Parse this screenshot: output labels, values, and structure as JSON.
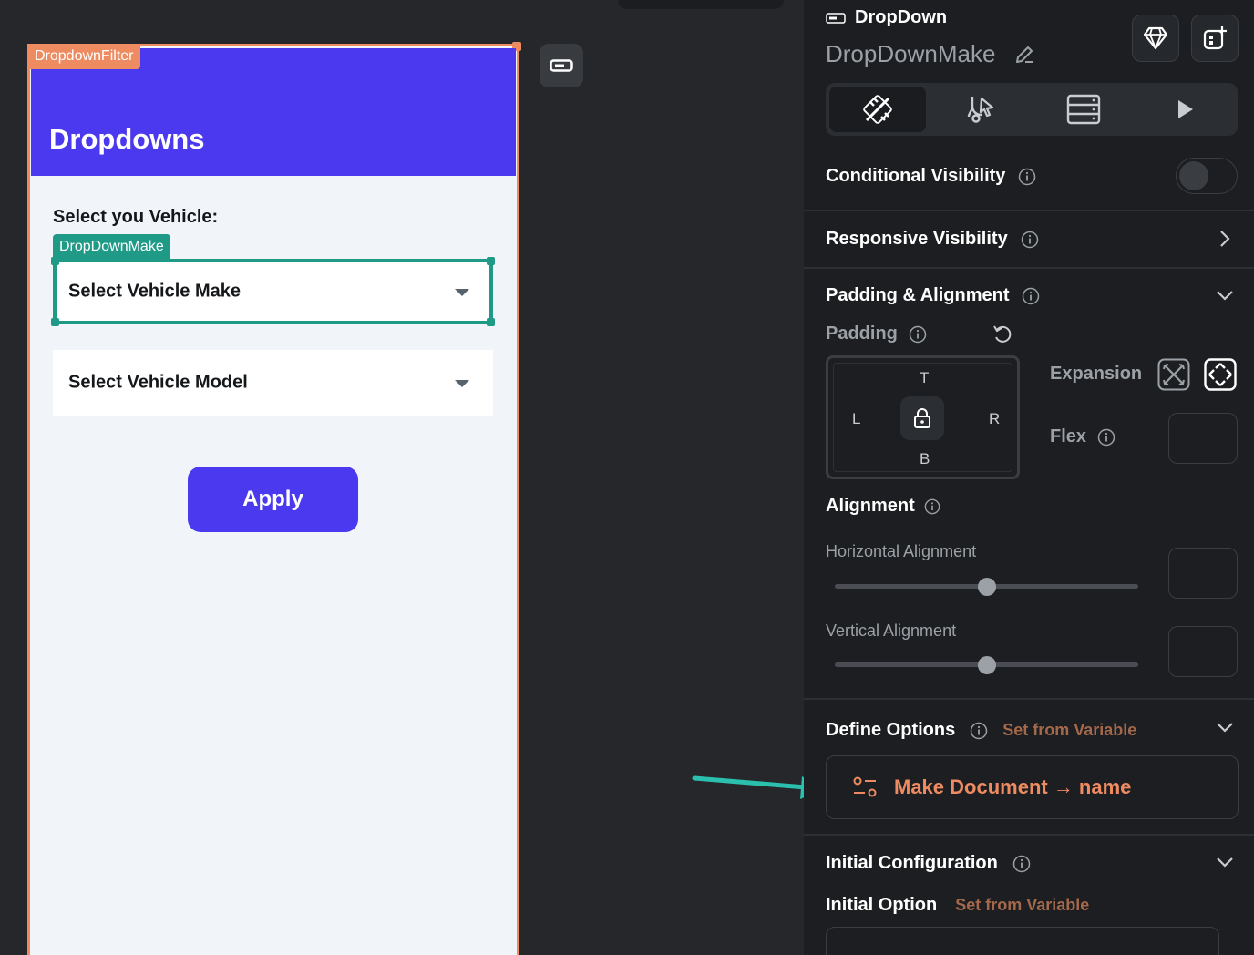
{
  "canvas": {
    "component_tag": "DropdownFilter",
    "appbar_title": "Dropdowns",
    "section_label": "Select you Vehicle:",
    "dropdown_tag": "DropDownMake",
    "dropdown_make_placeholder": "Select Vehicle Make",
    "dropdown_model_placeholder": "Select Vehicle Model",
    "apply_label": "Apply"
  },
  "panel": {
    "widget_type": "DropDown",
    "widget_name": "DropDownMake",
    "conditional_visibility": "Conditional Visibility",
    "responsive_visibility": "Responsive Visibility",
    "padding_alignment": "Padding & Alignment",
    "padding": "Padding",
    "pad_top": "T",
    "pad_left": "L",
    "pad_right": "R",
    "pad_bottom": "B",
    "expansion": "Expansion",
    "flex": "Flex",
    "alignment": "Alignment",
    "horizontal_alignment": "Horizontal Alignment",
    "vertical_alignment": "Vertical Alignment",
    "define_options": "Define Options",
    "set_from_variable": "Set from Variable",
    "options_value": "Make Document → name",
    "initial_configuration": "Initial Configuration",
    "initial_option": "Initial Option",
    "initial_set_from_variable": "Set from Variable"
  },
  "state": {
    "conditional_visibility_on": false,
    "horizontal_alignment_value": 0.5,
    "vertical_alignment_value": 0.5
  },
  "colors": {
    "accent": "#4b39ef",
    "selection_orange": "#ee8b60",
    "selection_teal": "#1f9a86",
    "annotation_arrow": "#2bbfae"
  }
}
